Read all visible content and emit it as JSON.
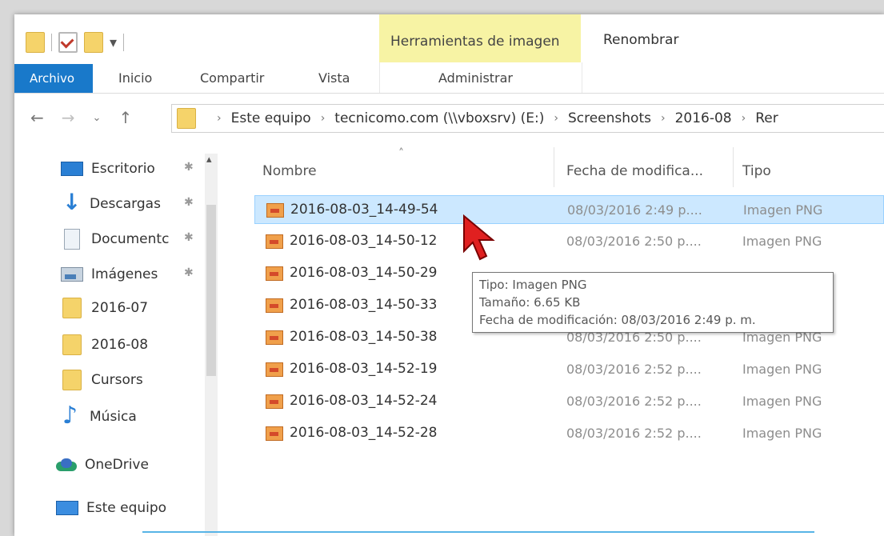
{
  "quick_access": {
    "dropdown_glyph": "▾"
  },
  "ribbon": {
    "context_title": "Herramientas de imagen",
    "rename_tab": "Renombrar",
    "tabs": [
      "Archivo",
      "Inicio",
      "Compartir",
      "Vista",
      "Administrar"
    ]
  },
  "nav": {
    "back": "←",
    "forward": "→",
    "recent": "⌄",
    "up": "↑"
  },
  "address": {
    "segments": [
      "Este equipo",
      "tecnicomo.com (\\\\vboxsrv) (E:)",
      "Screenshots",
      "2016-08",
      "Rer"
    ],
    "separator": "›"
  },
  "sidebar": {
    "items": [
      {
        "label": "Escritorio",
        "icon": "desktop-icon",
        "pinned": true
      },
      {
        "label": "Descargas",
        "icon": "download-icon",
        "pinned": true
      },
      {
        "label": "Documentc",
        "icon": "document-icon",
        "pinned": true
      },
      {
        "label": "Imágenes",
        "icon": "pictures-icon",
        "pinned": true
      },
      {
        "label": "2016-07",
        "icon": "folder-icon",
        "pinned": false
      },
      {
        "label": "2016-08",
        "icon": "folder-icon",
        "pinned": false
      },
      {
        "label": "Cursors",
        "icon": "folder-icon",
        "pinned": false
      },
      {
        "label": "Música",
        "icon": "music-icon",
        "pinned": false
      },
      {
        "label": "OneDrive",
        "icon": "onedrive-icon",
        "pinned": false
      },
      {
        "label": "Este equipo",
        "icon": "this-pc-icon",
        "pinned": false
      }
    ],
    "pin_glyph": "✱",
    "scroll_up": "▴"
  },
  "columns": {
    "name": "Nombre",
    "date": "Fecha de modifica...",
    "type": "Tipo",
    "sort_glyph": "˄"
  },
  "files": [
    {
      "name": "2016-08-03_14-49-54",
      "date": "08/03/2016 2:49 p....",
      "type": "Imagen PNG",
      "selected": true
    },
    {
      "name": "2016-08-03_14-50-12",
      "date": "08/03/2016 2:50 p....",
      "type": "Imagen PNG",
      "selected": false
    },
    {
      "name": "2016-08-03_14-50-29",
      "date": "",
      "type": "",
      "selected": false
    },
    {
      "name": "2016-08-03_14-50-33",
      "date": "",
      "type": "",
      "selected": false
    },
    {
      "name": "2016-08-03_14-50-38",
      "date": "08/03/2016 2:50 p....",
      "type": "Imagen PNG",
      "selected": false
    },
    {
      "name": "2016-08-03_14-52-19",
      "date": "08/03/2016 2:52 p....",
      "type": "Imagen PNG",
      "selected": false
    },
    {
      "name": "2016-08-03_14-52-24",
      "date": "08/03/2016 2:52 p....",
      "type": "Imagen PNG",
      "selected": false
    },
    {
      "name": "2016-08-03_14-52-28",
      "date": "08/03/2016 2:52 p....",
      "type": "Imagen PNG",
      "selected": false
    }
  ],
  "tooltip": {
    "line1": "Tipo: Imagen PNG",
    "line2": "Tamaño: 6.65 KB",
    "line3": "Fecha de modificación: 08/03/2016 2:49 p. m."
  },
  "colors": {
    "accent": "#1979ca",
    "context_tab": "#f7f3a4",
    "selection": "#cce8ff",
    "cursor": "#e02020"
  }
}
